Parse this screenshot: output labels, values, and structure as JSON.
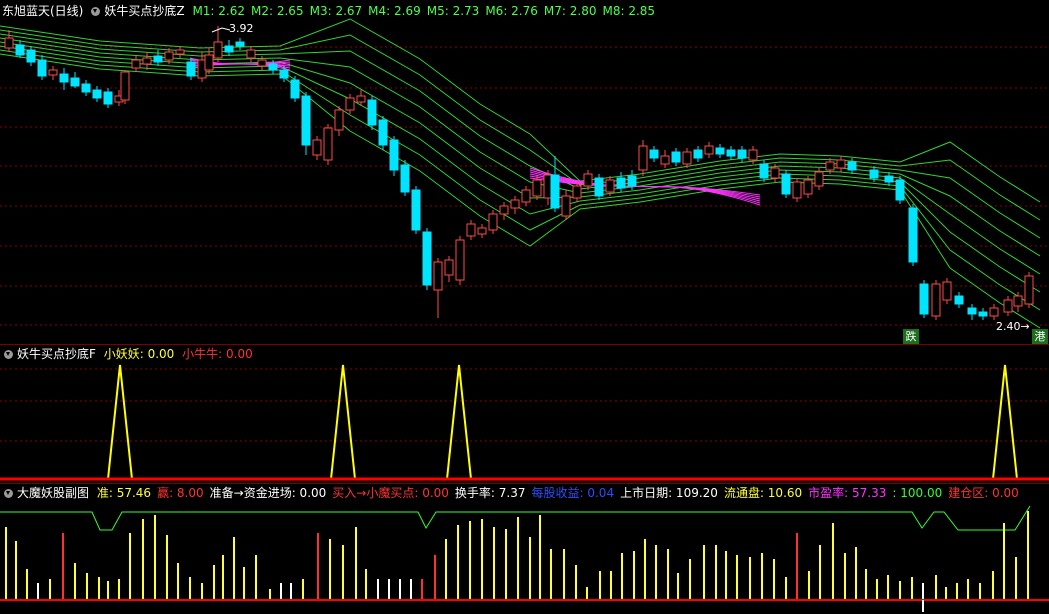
{
  "main": {
    "title": "东旭蓝天(日线)",
    "indicator": "妖牛买点抄底Z",
    "ma": [
      {
        "label": "M1: 2.62",
        "color": "#4cff4c"
      },
      {
        "label": "M2: 2.65",
        "color": "#4cff4c"
      },
      {
        "label": "M3: 2.67",
        "color": "#4cff4c"
      },
      {
        "label": "M4: 2.69",
        "color": "#4cff4c"
      },
      {
        "label": "M5: 2.73",
        "color": "#4cff4c"
      },
      {
        "label": "M6: 2.76",
        "color": "#4cff4c"
      },
      {
        "label": "M7: 2.80",
        "color": "#4cff4c"
      },
      {
        "label": "M8: 2.85",
        "color": "#4cff4c"
      }
    ],
    "high_label": "3.92",
    "low_label": "2.40",
    "signal_die": "跌",
    "signal_gang": "港"
  },
  "sub1": {
    "title": "妖牛买点抄底F",
    "v1": "小妖妖: 0.00",
    "v2": "小牛牛: 0.00"
  },
  "sub2": {
    "title": "大魔妖股副图",
    "items": [
      {
        "label": "准: 57.46",
        "color": "#ffff33"
      },
      {
        "label": "赢: 8.00",
        "color": "#ff3333"
      },
      {
        "label": "准备→资金进场: 0.00",
        "color": "#ffffff"
      },
      {
        "label": "买入→小魔买点: 0.00",
        "color": "#ff3333"
      },
      {
        "label": "换手率: 7.37",
        "color": "#ffffff"
      },
      {
        "label": "每股收益: 0.04",
        "color": "#2a4dff"
      },
      {
        "label": "上市日期: 109.20",
        "color": "#ffffff"
      },
      {
        "label": "流通盘: 10.60",
        "color": "#ffff33"
      },
      {
        "label": "市盈率: 57.33",
        "color": "#ff33ff"
      },
      {
        "label": ": 100.00",
        "color": "#33ff33"
      },
      {
        "label": "建仓区: 0.00",
        "color": "#ff3333"
      }
    ]
  },
  "colors": {
    "up": "#ff4a4a",
    "down": "#00e5ff",
    "ribbon": "#32d232",
    "ribbon_mix": "#ff33ff",
    "grid": "#8a0000",
    "spike": "#ffff00",
    "baseline": "#ff0000",
    "green_line": "#33ff33"
  }
}
